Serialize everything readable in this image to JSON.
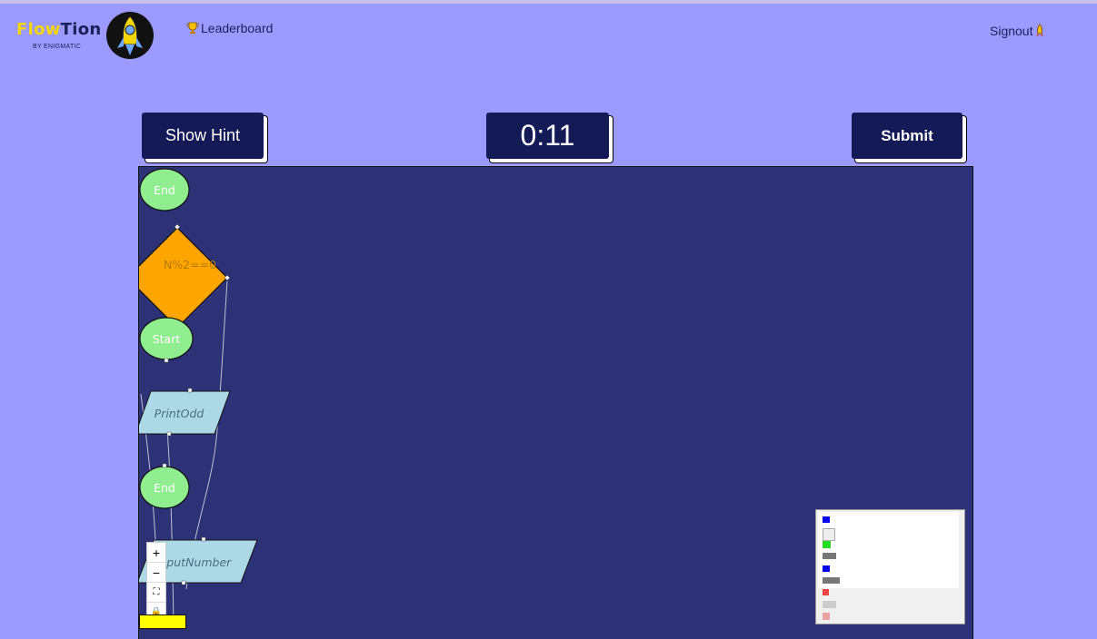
{
  "header": {
    "logo_flow": "Flow",
    "logo_tion": "Tion",
    "logo_sub": "BY ENIGMATIC",
    "leaderboard_label": "Leaderboard",
    "signout_label": "Signout"
  },
  "controls": {
    "show_hint_label": "Show Hint",
    "timer": "0:11",
    "submit_label": "Submit"
  },
  "flowchart": {
    "nodes": [
      {
        "id": "end-1",
        "shape": "terminal",
        "label": "End",
        "fill": "#90ee90"
      },
      {
        "id": "decision",
        "shape": "decision",
        "label": "N%2==0",
        "fill": "#ffa500"
      },
      {
        "id": "start",
        "shape": "terminal",
        "label": "Start",
        "fill": "#90ee90"
      },
      {
        "id": "print-odd",
        "shape": "io",
        "label": "PrintOdd",
        "fill": "#add8e6"
      },
      {
        "id": "end-2",
        "shape": "terminal",
        "label": "End",
        "fill": "#90ee90"
      },
      {
        "id": "input-number",
        "shape": "io",
        "label": "InputNumber",
        "fill": "#add8e6"
      }
    ]
  },
  "zoom_controls": {
    "zoom_in": "+",
    "zoom_out": "−",
    "fit_view": "⛶",
    "lock": "🔒"
  },
  "colors": {
    "background": "#9b9bff",
    "canvas": "#2d3277",
    "button": "#141a56",
    "accent": "#f5d60a"
  }
}
